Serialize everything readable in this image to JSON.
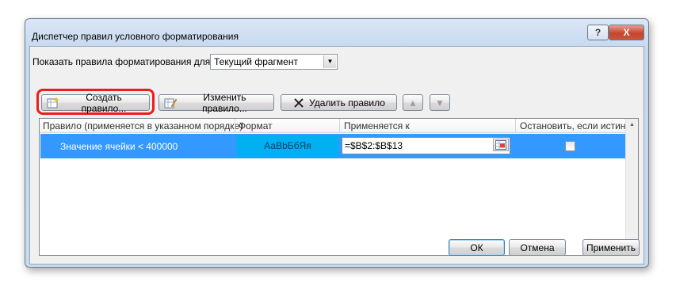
{
  "dialog": {
    "title": "Диспетчер правил условного форматирования",
    "help_label": "?",
    "close_label": "X"
  },
  "show_rules": {
    "label": "Показать правила форматирования для:",
    "selected": "Текущий фрагмент"
  },
  "toolbar": {
    "new_rule": "Создать правило...",
    "edit_rule": "Изменить правило...",
    "delete_rule": "Удалить правило",
    "move_up": "▲",
    "move_down": "▼"
  },
  "columns": {
    "rule": "Правило (применяется в указанном порядке)",
    "format": "Формат",
    "applies_to": "Применяется к",
    "stop_if_true": "Остановить, если истина"
  },
  "rules": [
    {
      "rule": "Значение ячейки < 400000",
      "format_preview": "АаBbБбЯя",
      "applies_to": "=$B$2:$B$13",
      "stop_if_true": false
    }
  ],
  "footer": {
    "ok": "ОК",
    "cancel": "Отмена",
    "apply": "Применить"
  },
  "colors": {
    "selection": "#3399ff",
    "preview_fill": "#00b0f0",
    "highlight": "#ee1c1c"
  }
}
